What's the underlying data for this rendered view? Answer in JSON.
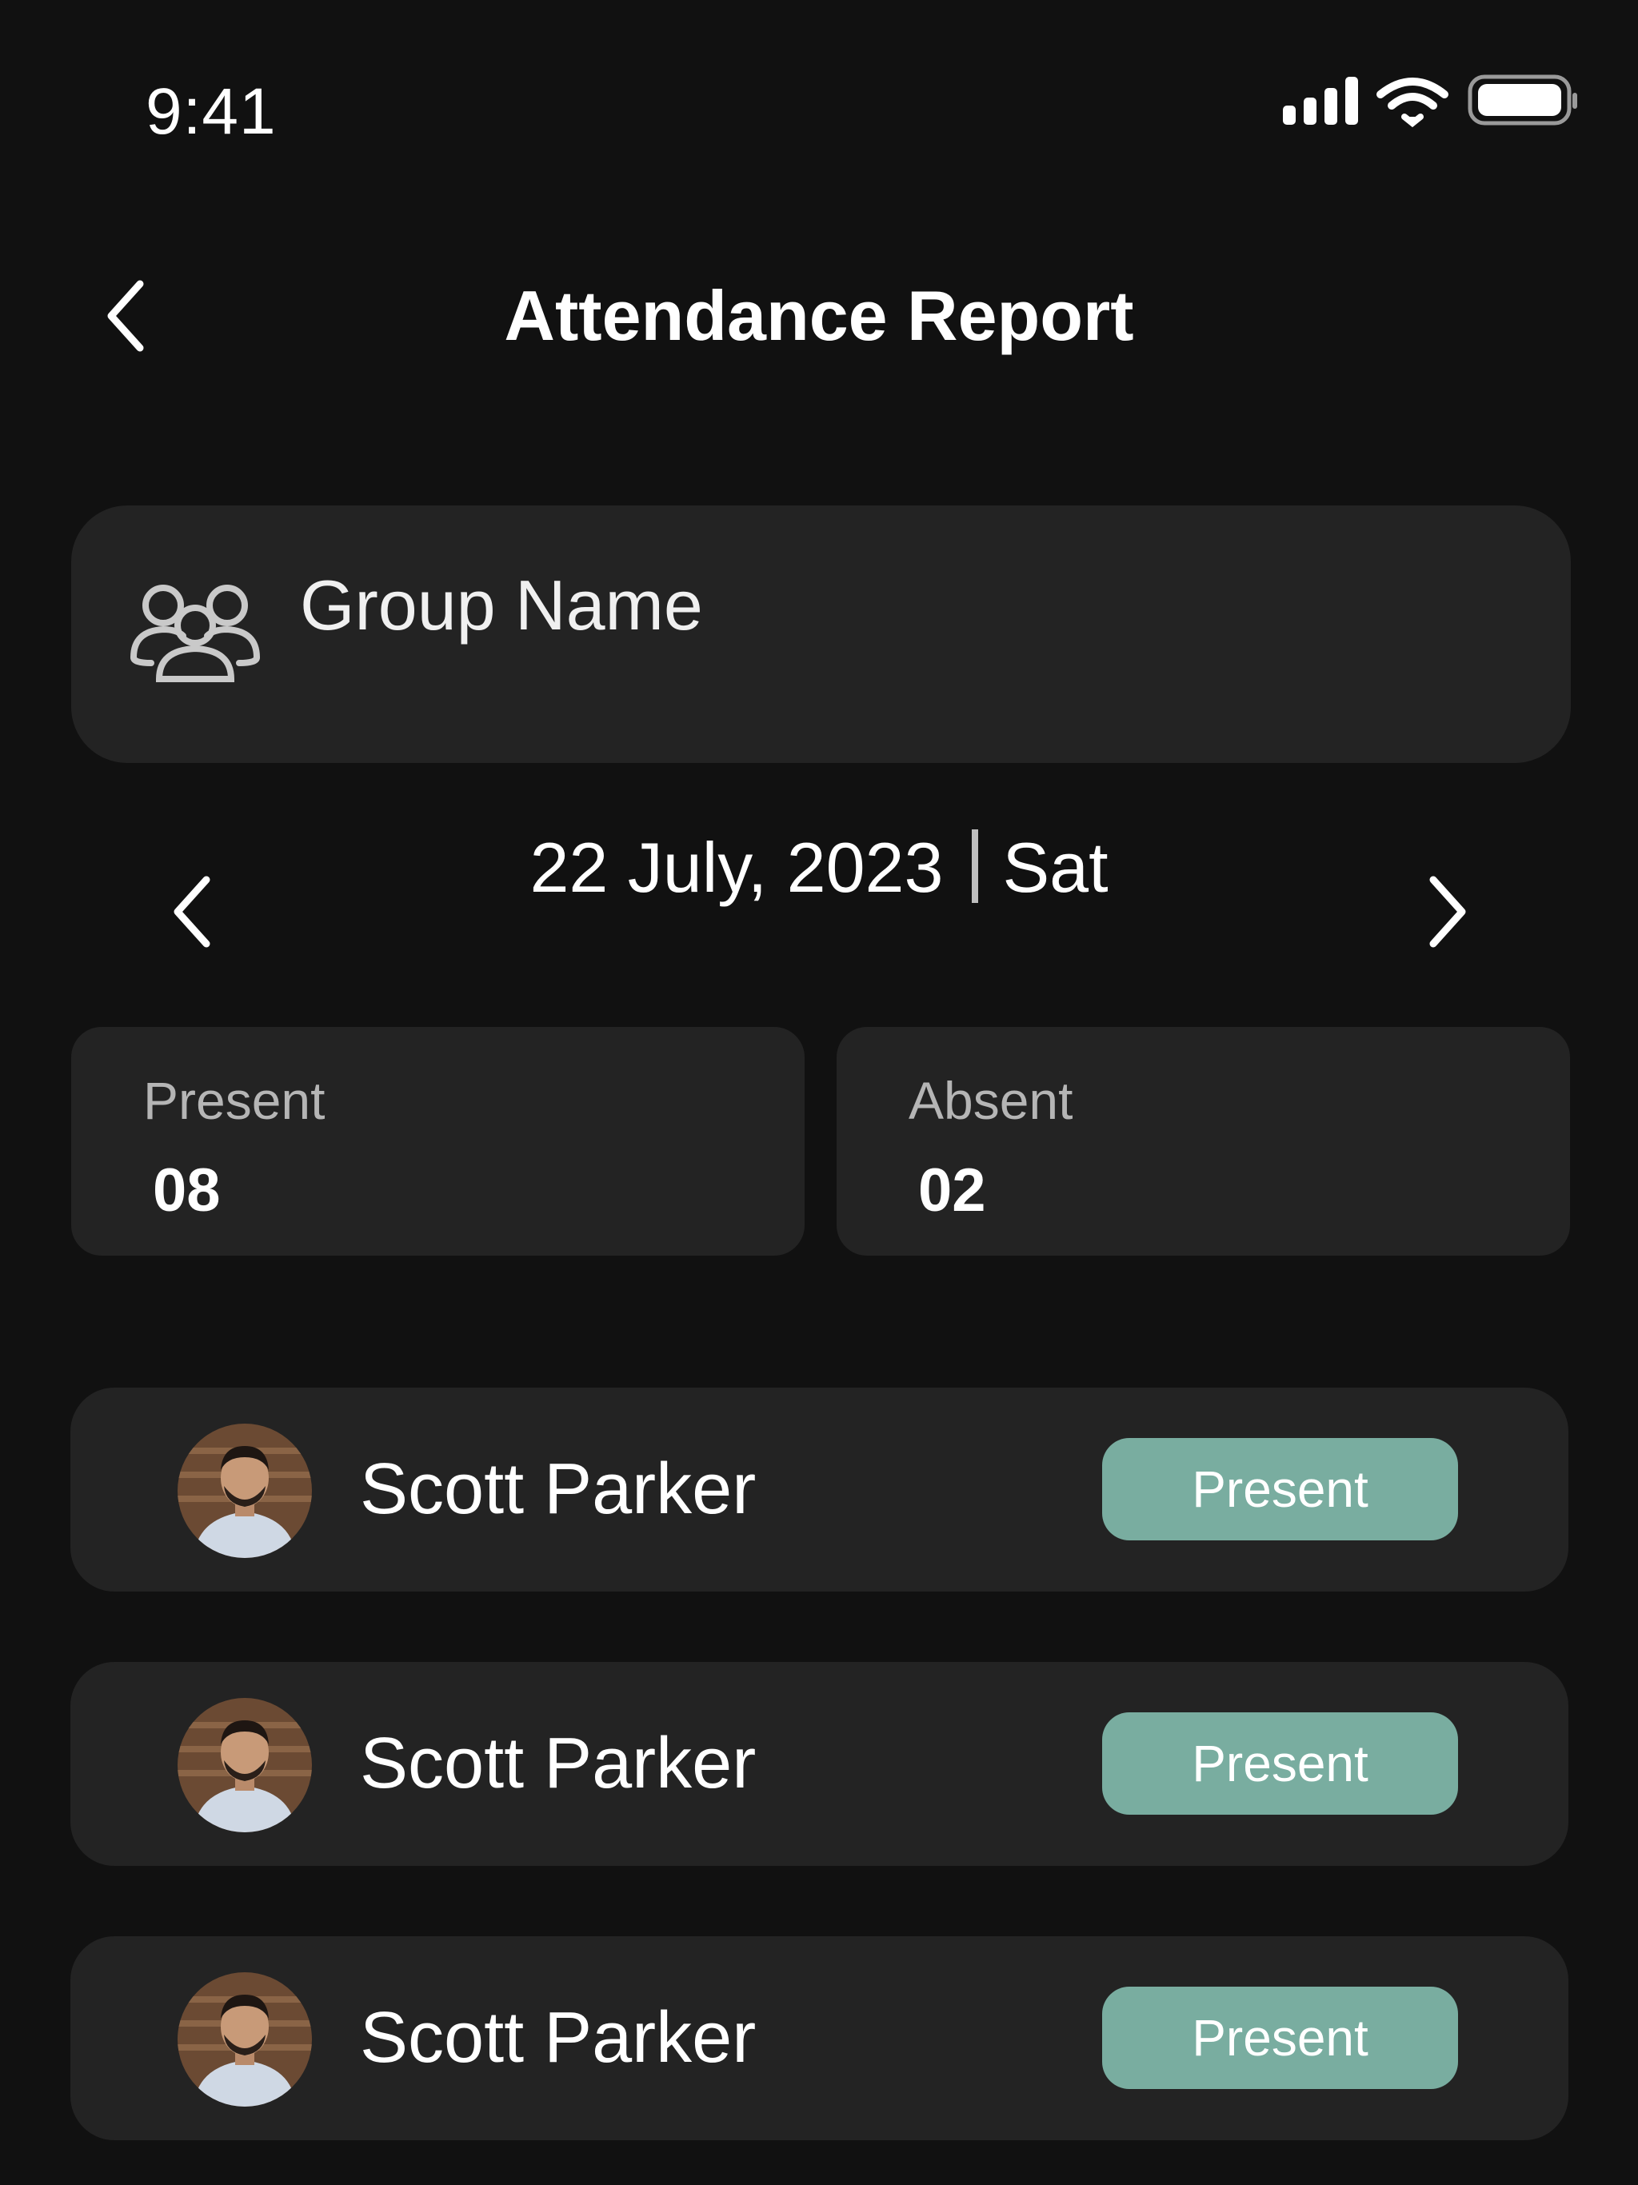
{
  "status_bar": {
    "time": "9:41"
  },
  "header": {
    "title": "Attendance Report"
  },
  "group": {
    "name": "Group Name",
    "icon": "group-icon"
  },
  "date_nav": {
    "date": "22 July, 2023",
    "day": "Sat"
  },
  "stats": {
    "present_label": "Present",
    "present_value": "08",
    "absent_label": "Absent",
    "absent_value": "02"
  },
  "members": [
    {
      "name": "Scott Parker",
      "status": "Present"
    },
    {
      "name": "Scott Parker",
      "status": "Present"
    },
    {
      "name": "Scott Parker",
      "status": "Present"
    }
  ],
  "colors": {
    "background": "#111111",
    "card": "#232323",
    "present_pill": "#79ada0",
    "muted_text": "#b5b5b5"
  }
}
